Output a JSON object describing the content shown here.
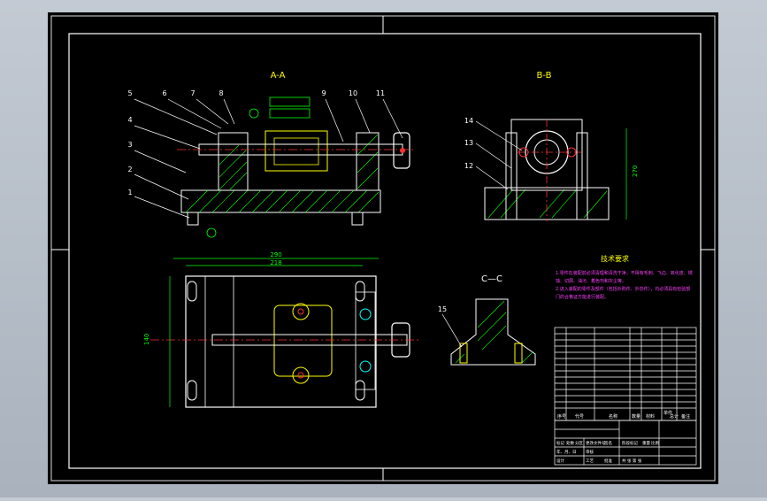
{
  "views": {
    "section_aa": "A-A",
    "section_bb": "B-B",
    "section_cc": "C—C"
  },
  "balloons_aa": [
    "1",
    "2",
    "3",
    "4",
    "5",
    "6",
    "7",
    "8",
    "9",
    "10",
    "11"
  ],
  "balloons_bb": [
    "12",
    "13",
    "14"
  ],
  "balloon_cc": "15",
  "dimensions": {
    "overall_length": "290",
    "inner_length": "218",
    "height_bb": "270",
    "width_left": "140"
  },
  "tech_requirements": {
    "title": "技术要求",
    "lines": [
      "1.零件在装配前必须清理和清洗干净，不得有毛刺、飞边、氧化皮、锈",
      "蚀、切屑、油污、着色剂和灰尘等。",
      "2.进入装配的零件及部件（包括外购件、外协件），均必须具有检验部",
      "门的合格证方能进行装配。"
    ]
  },
  "title_block": {
    "header": [
      "序号",
      "代号",
      "名称",
      "数量",
      "材料",
      "单件",
      "总计",
      "备注"
    ],
    "bottom_labels": [
      "标记",
      "处数",
      "分区",
      "更改文件号",
      "签名",
      "年、月、日",
      "设计",
      "审核",
      "工艺",
      "批准"
    ],
    "stage_labels": [
      "阶段标记",
      "重量",
      "比例"
    ],
    "page": "共  张  第  张"
  }
}
